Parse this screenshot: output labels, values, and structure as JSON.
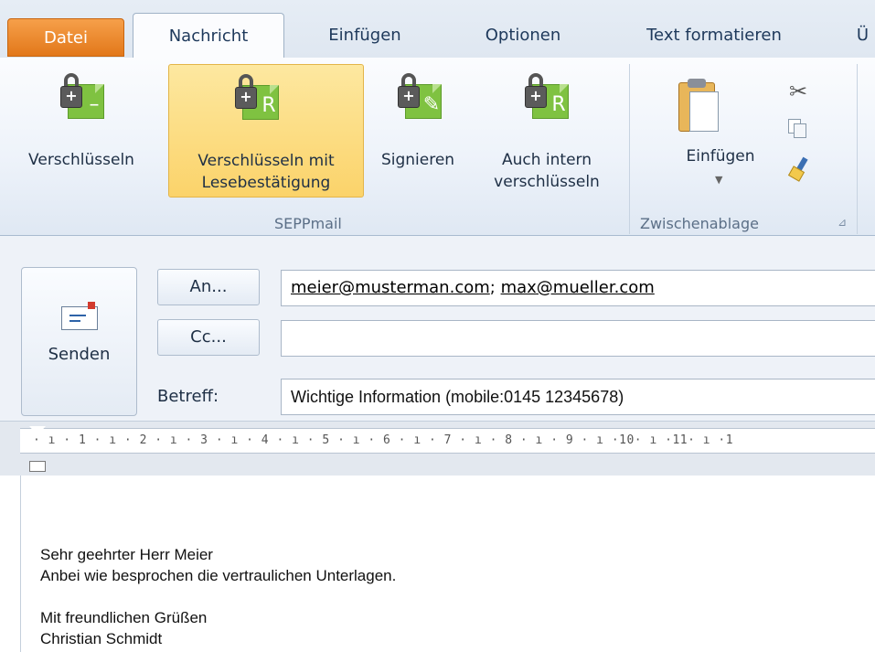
{
  "tabs": [
    {
      "label": "Datei"
    },
    {
      "label": "Nachricht"
    },
    {
      "label": "Einfügen"
    },
    {
      "label": "Optionen"
    },
    {
      "label": "Text formatieren"
    },
    {
      "label": "Ü"
    }
  ],
  "ribbon": {
    "seppmail": {
      "group_label": "SEPPmail",
      "buttons": [
        {
          "label": "Verschlüsseln"
        },
        {
          "label_line1": "Verschlüsseln mit",
          "label_line2": "Lesebestätigung"
        },
        {
          "label": "Signieren"
        },
        {
          "label_line1": "Auch intern",
          "label_line2": "verschlüsseln"
        }
      ],
      "icon_marks": [
        "–",
        "R",
        "✎",
        "R"
      ]
    },
    "clipboard": {
      "group_label": "Zwischenablage",
      "paste_label": "Einfügen",
      "launcher_glyph": "⊿"
    },
    "colors": {
      "accent_file_tab": "#e2781a",
      "highlight": "#fbd36a",
      "lock_doc": "#7fc241"
    }
  },
  "compose": {
    "send_label": "Senden",
    "to_button": "An...",
    "cc_button": "Cc...",
    "subject_label": "Betreff:",
    "to_recipients": [
      "meier@musterman.com",
      "max@mueller.com"
    ],
    "to_separator": "; ",
    "cc_value": "",
    "subject_value": "Wichtige Information (mobile:0145 12345678)"
  },
  "ruler": {
    "text": "· ı · 1 · ı · 2 · ı · 3 · ı · 4 · ı · 5 · ı · 6 · ı · 7 · ı · 8 · ı · 9 · ı ·10· ı ·11· ı ·1"
  },
  "body": {
    "lines": [
      "Sehr geehrter Herr Meier",
      "Anbei wie besprochen die vertraulichen Unterlagen.",
      "",
      "Mit freundlichen Grüßen",
      "Christian Schmidt"
    ]
  }
}
